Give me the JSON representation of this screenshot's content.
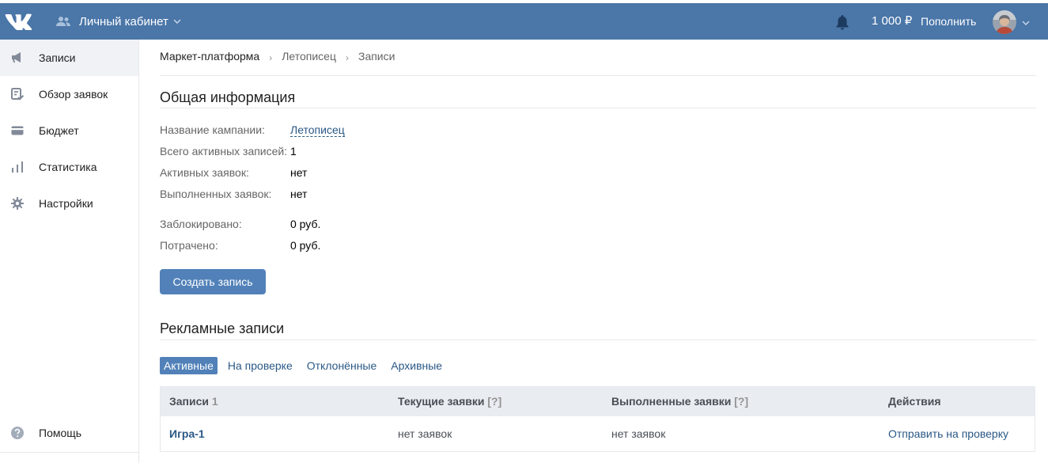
{
  "header": {
    "cabinet_label": "Личный кабинет",
    "balance": "1 000 ₽",
    "topup_label": "Пополнить"
  },
  "sidebar": {
    "items": [
      {
        "label": "Записи",
        "icon": "megaphone-icon",
        "active": true
      },
      {
        "label": "Обзор заявок",
        "icon": "review-check-icon"
      },
      {
        "label": "Бюджет",
        "icon": "wallet-icon"
      },
      {
        "label": "Статистика",
        "icon": "bar-chart-icon"
      },
      {
        "label": "Настройки",
        "icon": "gear-icon"
      }
    ],
    "help_label": "Помощь"
  },
  "breadcrumbs": [
    "Маркет-платформа",
    "Летописец",
    "Записи"
  ],
  "general": {
    "title": "Общая информация",
    "rows": [
      {
        "label": "Название кампании:",
        "value": "Летописец"
      },
      {
        "label": "Всего активных записей:",
        "value": "1"
      },
      {
        "label": "Активных заявок:",
        "value": "нет"
      },
      {
        "label": "Выполненных заявок:",
        "value": "нет"
      },
      {
        "label": "Заблокировано:",
        "value": "0 руб."
      },
      {
        "label": "Потрачено:",
        "value": "0 руб."
      }
    ],
    "create_button": "Создать запись"
  },
  "ads": {
    "title": "Рекламные записи",
    "tabs": [
      "Активные",
      "На проверке",
      "Отклонённые",
      "Архивные"
    ],
    "active_tab": "Активные",
    "columns": {
      "posts": "Записи",
      "posts_count": "1",
      "current": "Текущие заявки",
      "done": "Выполненные заявки",
      "hint": "[?]",
      "actions": "Действия"
    },
    "rows": [
      {
        "name": "Игра-1",
        "current": "нет заявок",
        "done": "нет заявок",
        "action": "Отправить на проверку"
      }
    ]
  },
  "colors": {
    "header_bg": "#4a76a8",
    "button_bg": "#5181b8",
    "link": "#2a5885"
  }
}
